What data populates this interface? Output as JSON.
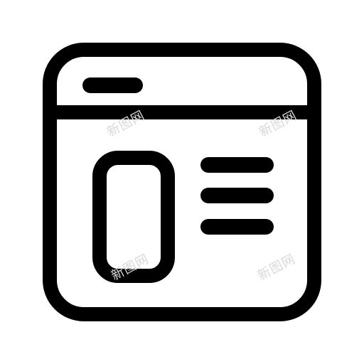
{
  "icon": {
    "name": "browser-window-layout-icon",
    "stroke_color": "#000000",
    "background_color": "#ffffff"
  },
  "watermark": {
    "text": "新图网",
    "color": "#d9d9d9"
  }
}
